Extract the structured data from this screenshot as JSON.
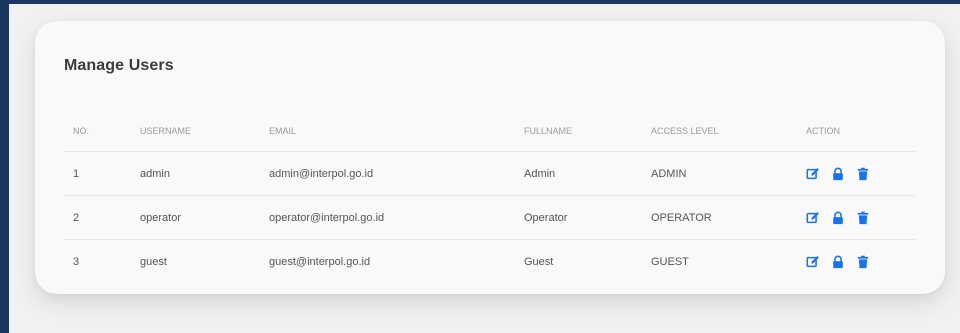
{
  "card": {
    "title": "Manage Users"
  },
  "table": {
    "headers": {
      "no": "NO.",
      "username": "USERNAME",
      "email": "EMAIL",
      "fullname": "FULLNAME",
      "access_level": "ACCESS LEVEL",
      "action": "ACTION"
    },
    "rows": [
      {
        "no": "1",
        "username": "admin",
        "email": "admin@interpol.go.id",
        "fullname": "Admin",
        "access_level": "ADMIN"
      },
      {
        "no": "2",
        "username": "operator",
        "email": "operator@interpol.go.id",
        "fullname": "Operator",
        "access_level": "OPERATOR"
      },
      {
        "no": "3",
        "username": "guest",
        "email": "guest@interpol.go.id",
        "fullname": "Guest",
        "access_level": "GUEST"
      }
    ],
    "action_icons": [
      "edit-icon",
      "lock-icon",
      "trash-icon"
    ]
  },
  "colors": {
    "accent": "#1a73e8",
    "sidebar": "#1b365f",
    "card_bg": "#f9f9f9",
    "page_bg": "#f1f1f3"
  }
}
